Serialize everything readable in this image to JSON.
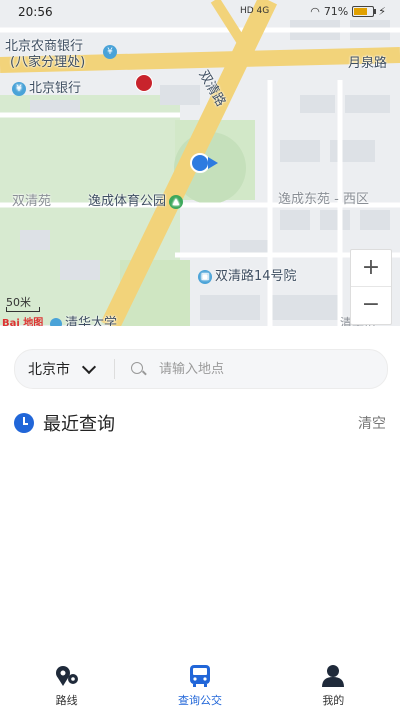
{
  "status_bar": {
    "time": "20:56",
    "network": "HD 4G",
    "battery": "71%",
    "battery_level": 0.71
  },
  "map": {
    "labels": {
      "bank1_line1": "北京农商银行",
      "bank1_line2": "(八家分理处)",
      "bank2": "北京银行",
      "road_east": "月泉路",
      "road_diag": "双清路",
      "gym": "逸成体育公园",
      "district_w": "双清苑",
      "district_e": "逸成东苑 - 西区",
      "building": "双清路14号院",
      "university": "清华大学",
      "partial_label": "清华街"
    },
    "scale": "50米",
    "zoom_in": "+",
    "zoom_out": "−",
    "logo": "Bai 地图"
  },
  "search": {
    "city": "北京市",
    "placeholder": "请输入地点"
  },
  "recent": {
    "title": "最近查询",
    "clear_label": "清空"
  },
  "tabs": [
    {
      "label": "路线",
      "icon": "route-pin-icon",
      "active": false
    },
    {
      "label": "查询公交",
      "icon": "bus-icon",
      "active": true
    },
    {
      "label": "我的",
      "icon": "person-icon",
      "active": false
    }
  ],
  "colors": {
    "accent": "#2166d8",
    "map_road": "#f2d37a",
    "map_green": "#cfe6c2"
  }
}
